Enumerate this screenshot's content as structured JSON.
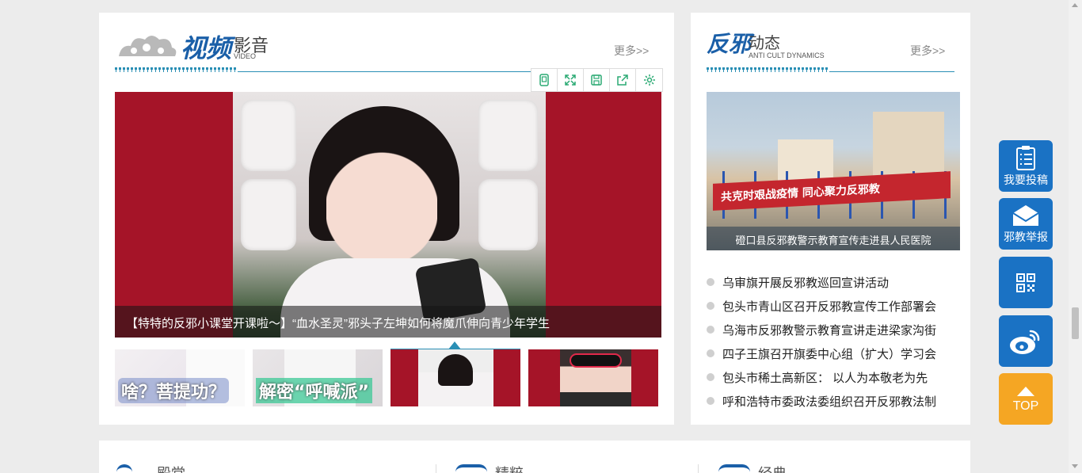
{
  "video_section": {
    "title_cn": "视频",
    "title_sub": "影音",
    "title_en": "VIDEO",
    "more": "更多>>",
    "toolbar": [
      "pad-icon",
      "expand-icon",
      "save-icon",
      "share-icon",
      "settings-icon"
    ],
    "main_caption": "【特特的反邪小课堂开课啦～】“血水圣灵”邪头子左坤如何将魔爪伸向青少年学生",
    "thumbnails": [
      {
        "label": "啥？菩提功？"
      },
      {
        "label": "解密“呼喊派”"
      },
      {
        "label": ""
      },
      {
        "label": ""
      }
    ],
    "active_thumbnail": 3
  },
  "news_section": {
    "title_cn": "反邪",
    "title_sub": "动态",
    "title_en": "ANTI CULT DYNAMICS",
    "more": "更多>>",
    "image_banner_text": "共克时艰战疫情  同心聚力反邪教",
    "image_caption": "磴口县反邪教警示教育宣传走进县人民医院",
    "items": [
      "乌审旗开展反邪教巡回宣讲活动",
      "包头市青山区召开反邪教宣传工作部署会",
      "乌海市反邪教警示教育宣讲走进梁家沟街",
      "四子王旗召开旗委中心组（扩大）学习会",
      "包头市稀土高新区： 以人为本敬老为先",
      "呼和浩特市委政法委组织召开反邪教法制"
    ]
  },
  "bottom_section": {
    "titles": [
      "殿堂",
      "精粹",
      "经典"
    ]
  },
  "side_buttons": {
    "submit": "我要投稿",
    "report": "邪教举报",
    "top": "TOP"
  },
  "colors": {
    "accent_blue": "#1a72c4",
    "rule_teal": "#2a8fb5",
    "video_bg": "#a51428",
    "top_orange": "#f5a623"
  }
}
